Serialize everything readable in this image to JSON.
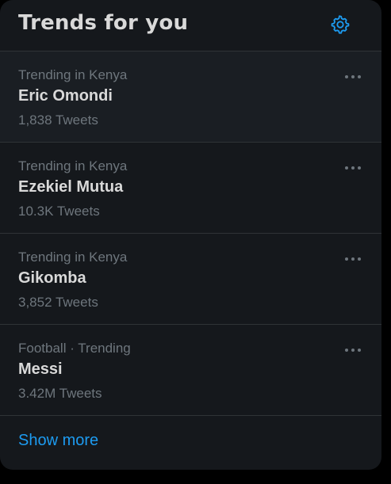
{
  "header": {
    "title": "Trends for you",
    "settings_icon": "gear-icon"
  },
  "trends": [
    {
      "context": "Trending in Kenya",
      "name": "Eric Omondi",
      "count": "1,838 Tweets"
    },
    {
      "context": "Trending in Kenya",
      "name": "Ezekiel Mutua",
      "count": "10.3K Tweets"
    },
    {
      "context": "Trending in Kenya",
      "name": "Gikomba",
      "count": "3,852 Tweets"
    },
    {
      "context": "Football · Trending",
      "name": "Messi",
      "count": "3.42M Tweets"
    }
  ],
  "footer": {
    "show_more": "Show more"
  },
  "colors": {
    "background": "#000000",
    "panel": "#15181c",
    "accent": "#1d9bf0",
    "text_primary": "#d9d9d9",
    "text_secondary": "#6e767d"
  }
}
